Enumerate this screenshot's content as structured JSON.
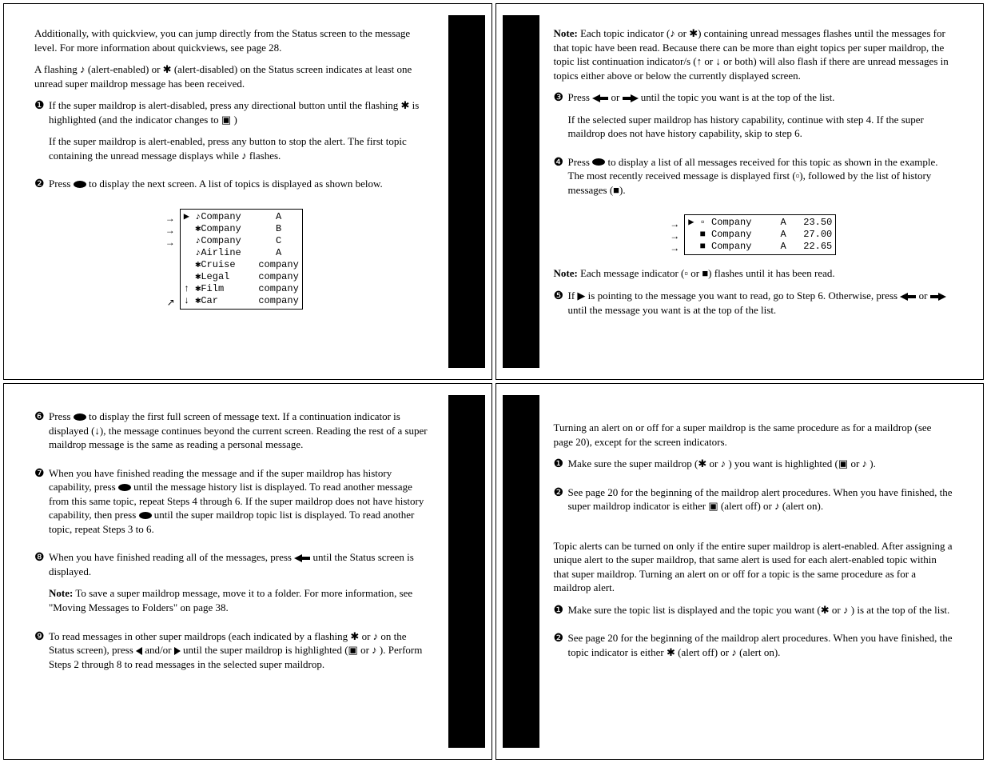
{
  "page1": {
    "p1": "Additionally, with quickview, you can jump directly from the Status screen to the message level. For more information about quickviews, see page 28.",
    "p2a": "A flashing ",
    "p2b": " (alert-enabled) or ",
    "p2c": " (alert-disabled) on the Status screen indicates at least one unread super maildrop message has been received.",
    "s1a": "If the super maildrop is alert-disabled, press any directional button until the flashing ",
    "s1b": " is highlighted (and the indicator changes to ",
    "s1c": " )",
    "s1p2a": "If the super maildrop is alert-enabled, press any button to stop the alert. The first topic containing the unread message displays while ",
    "s1p2b": " flashes.",
    "s2a": "Press ",
    "s2b": " to display the next screen. A list of topics is displayed as shown below.",
    "screen": "▶ ♪Company      A\n  ✱Company      B\n  ♪Company      C\n  ♪Airline      A\n  ✱Cruise    company\n  ✱Legal     company\n↑ ✱Film      company\n↓ ✱Car       company",
    "arrows": "→\n→\n→\n\n\n\n\n↗"
  },
  "page2": {
    "note1a": "Note:",
    "note1b": " Each topic indicator (",
    "note1c": " or ",
    "note1d": ") containing unread messages flashes until the messages for that topic have been read. Because there can be more than eight topics per super maildrop, the topic list continuation indicator/s (↑ or ↓ or both) will also flash if there are unread messages in topics either above or below the currently displayed screen.",
    "s3a": "Press ",
    "s3b": " or ",
    "s3c": " until the topic you want is at the top of the list.",
    "s3p2": "If the selected super maildrop has history capability, continue with step 4. If the super maildrop does not have history capability, skip to step 6.",
    "s4a": "Press ",
    "s4b": " to display a list of all messages received for this topic as shown in the example. The most recently received message is displayed first (",
    "s4c": "), followed by the list of history messages (■).",
    "screen": "▶ ▫ Company     A   23.50\n  ■ Company     A   27.00\n  ■ Company     A   22.65",
    "arrows": "→\n→\n→",
    "note2a": "Note:",
    "note2b": " Each message indicator (",
    "note2c": " or ■) flashes until it has been read.",
    "s5a": "If ▶ is pointing to the message you want to read, go to Step 6. Otherwise, press ",
    "s5b": " or ",
    "s5c": " until the message you want is at the top of the list."
  },
  "page3": {
    "s6a": "Press ",
    "s6b": " to display the first full screen of message text. If a continuation indicator is displayed (↓), the message continues beyond the current screen. Reading the rest of a super maildrop message is the same as reading a personal message.",
    "s7a": "When you have finished reading the message and if the super maildrop has history capability, press ",
    "s7b": " until the message history list is displayed. To read another message from this same topic, repeat Steps 4 through 6. If the super maildrop does not have history capability, then press ",
    "s7c": " until the super maildrop topic list is displayed. To read another topic, repeat Steps 3 to 6.",
    "s8a": "When you have finished reading all of the messages, press ",
    "s8b": " until the Status screen is displayed.",
    "note_a": "Note:",
    "note_b": " To save a super maildrop message, move it to a folder. For more information, see \"Moving Messages to Folders\" on page 38.",
    "s9a": "To read messages in other super maildrops (each indicated by a flashing ",
    "s9b": " or ",
    "s9c": " on the Status screen), press ",
    "s9d": " and/or ",
    "s9e": " until the super maildrop is highlighted (",
    "s9f": " or ",
    "s9g": "). Perform Steps 2 through 8 to read messages in the selected super maildrop."
  },
  "page4": {
    "p1": "Turning an alert on or off for a super maildrop is the same procedure as for a maildrop (see page 20), except for the screen indicators.",
    "a1a": "Make sure the super maildrop (",
    "a1b": " or ",
    "a1c": " ) you want is highlighted (",
    "a1d": " or ",
    "a1e": ").",
    "a2a": " See page 20 for the beginning of the maildrop alert procedures. When you have finished, the super maildrop indicator is either ",
    "a2b": " (alert off) or ",
    "a2c": " (alert on).",
    "p2": "Topic alerts can be turned on only if the entire super maildrop is alert-enabled. After assigning a unique alert to the super maildrop, that same alert is used for each alert-enabled topic within that super maildrop. Turning an alert on or off for a topic is the same procedure as for a maildrop alert.",
    "b1a": "Make sure the topic list is displayed and the topic you want (",
    "b1b": " or ",
    "b1c": ") is at the top of the list.",
    "b2a": "See page 20 for the beginning of the maildrop alert procedures. When you have finished, the topic indicator is either ",
    "b2b": " (alert off) or ",
    "b2c": " (alert on)."
  },
  "num": {
    "n1": "❶",
    "n2": "❷",
    "n3": "❸",
    "n4": "❹",
    "n5": "❺",
    "n6": "❻",
    "n7": "❼",
    "n8": "❽",
    "n9": "❾"
  },
  "glyph": {
    "note_on": "♪",
    "note_off": "✱",
    "msg_unread": "▫",
    "msg_read": "■",
    "mail": "✉",
    "mail_hl": "▣"
  }
}
